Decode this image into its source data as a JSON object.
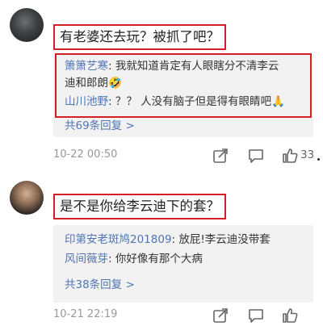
{
  "comments": [
    {
      "main_text": "有老婆还去玩？被抓了吧？",
      "replies": [
        {
          "author": "箫箫艺寒",
          "text": ": 我就知道肯定有人眼瞎分不清李云"
        },
        {
          "author": "",
          "text": "迪和郎朗🤣"
        },
        {
          "author": "山川池野",
          "text": ": ？？ 人没有脑子但是得有眼睛吧🙏"
        }
      ],
      "more_replies": "共69条回复 >",
      "time": "10-22 00:50",
      "likes": "33"
    },
    {
      "main_text": "是不是你给李云迪下的套？",
      "replies": [
        {
          "author": "印第安老斑鸠201809",
          "text": ": 放屁!李云迪没带套"
        },
        {
          "author": "风间薇芽",
          "text": ": 你好像有那个大病"
        }
      ],
      "more_replies": "共38条回复 >",
      "time": "10-21 22:19",
      "likes": ""
    }
  ],
  "icons": {
    "share": "share-icon",
    "comment": "comment-icon",
    "like": "thumbs-up-icon"
  }
}
